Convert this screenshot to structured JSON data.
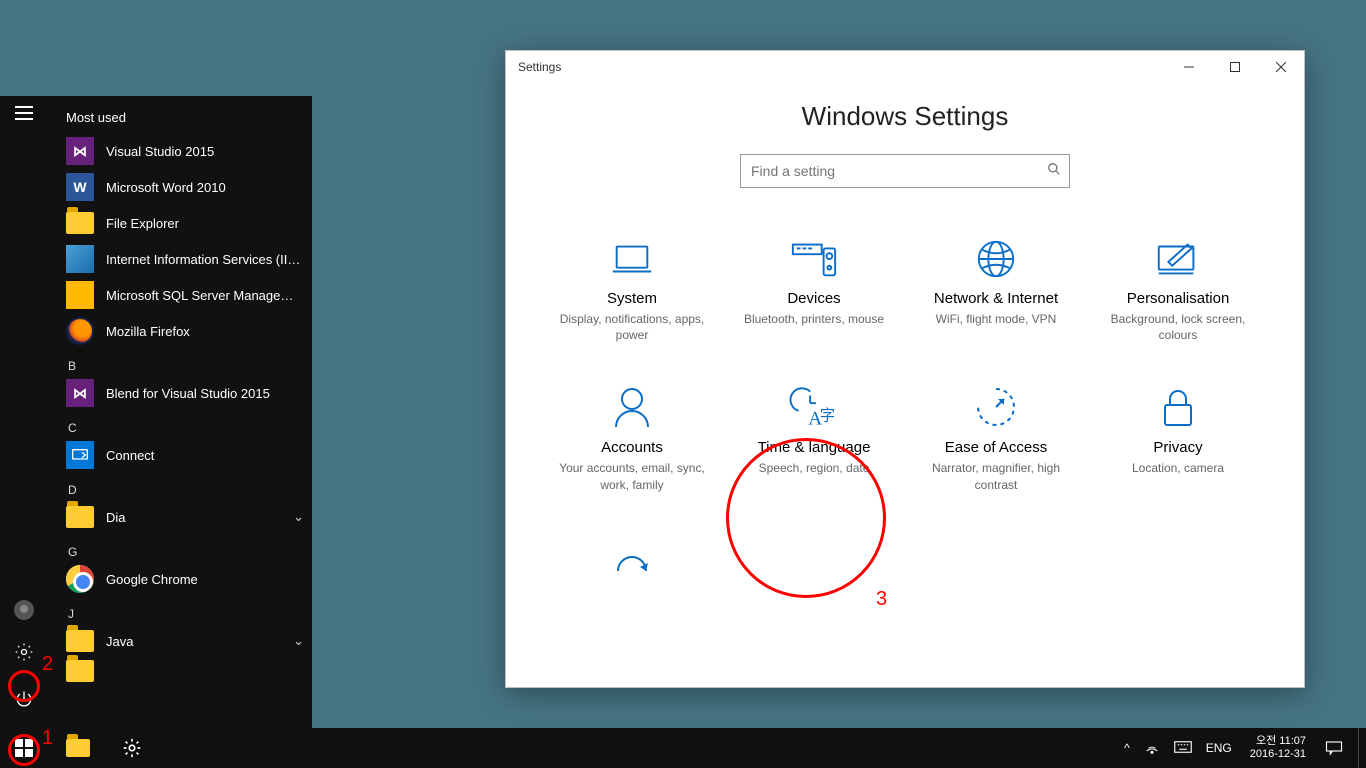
{
  "startMenu": {
    "mostUsedHeader": "Most used",
    "mostUsed": [
      {
        "label": "Visual Studio 2015",
        "tile": "tile-purple",
        "glyph": "⋈"
      },
      {
        "label": "Microsoft Word 2010",
        "tile": "tile-blue",
        "glyph": "W"
      },
      {
        "label": "File Explorer",
        "tile": "tile-folder",
        "glyph": ""
      },
      {
        "label": "Internet Information Services (IIS)...",
        "tile": "tile-iis",
        "glyph": ""
      },
      {
        "label": "Microsoft SQL Server Managemen...",
        "tile": "tile-ssms",
        "glyph": ""
      },
      {
        "label": "Mozilla Firefox",
        "tile": "tile-ff",
        "glyph": ""
      }
    ],
    "groups": [
      {
        "letter": "B",
        "items": [
          {
            "label": "Blend for Visual Studio 2015",
            "tile": "tile-purple",
            "glyph": "⋈",
            "expand": false
          }
        ]
      },
      {
        "letter": "C",
        "items": [
          {
            "label": "Connect",
            "tile": "tile-teal",
            "glyph": "",
            "expand": false
          }
        ]
      },
      {
        "letter": "D",
        "items": [
          {
            "label": "Dia",
            "tile": "tile-folder",
            "glyph": "",
            "expand": true
          }
        ]
      },
      {
        "letter": "G",
        "items": [
          {
            "label": "Google Chrome",
            "tile": "tile-chrome",
            "glyph": "",
            "expand": false
          }
        ]
      },
      {
        "letter": "J",
        "items": [
          {
            "label": "Java",
            "tile": "tile-folder",
            "glyph": "",
            "expand": true
          }
        ]
      }
    ]
  },
  "settingsWindow": {
    "title": "Settings",
    "heading": "Windows Settings",
    "searchPlaceholder": "Find a setting",
    "categories": [
      {
        "title": "System",
        "desc": "Display, notifications, apps, power"
      },
      {
        "title": "Devices",
        "desc": "Bluetooth, printers, mouse"
      },
      {
        "title": "Network & Internet",
        "desc": "WiFi, flight mode, VPN"
      },
      {
        "title": "Personalisation",
        "desc": "Background, lock screen, colours"
      },
      {
        "title": "Accounts",
        "desc": "Your accounts, email, sync, work, family"
      },
      {
        "title": "Time & language",
        "desc": "Speech, region, date"
      },
      {
        "title": "Ease of Access",
        "desc": "Narrator, magnifier, high contrast"
      },
      {
        "title": "Privacy",
        "desc": "Location, camera"
      }
    ]
  },
  "annotations": {
    "n1": "1",
    "n2": "2",
    "n3": "3"
  },
  "taskbar": {
    "ime": "ENG",
    "time": "오전 11:07",
    "date": "2016-12-31"
  }
}
